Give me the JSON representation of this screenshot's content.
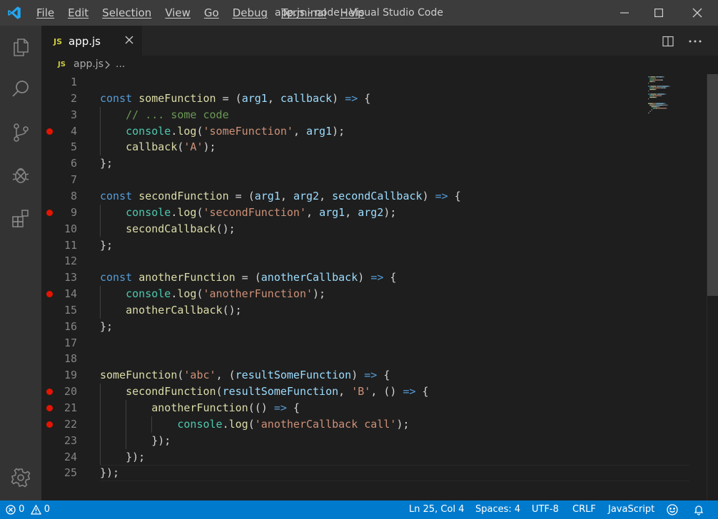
{
  "window": {
    "title": "app.js - node - Visual Studio Code",
    "menu": [
      "File",
      "Edit",
      "Selection",
      "View",
      "Go",
      "Debug",
      "Terminal",
      "Help"
    ]
  },
  "tab": {
    "icon_label": "JS",
    "file": "app.js"
  },
  "breadcrumb": {
    "icon_label": "JS",
    "file": "app.js",
    "more": "..."
  },
  "editor": {
    "lines": [
      {
        "n": "1",
        "bp": false,
        "tokens": []
      },
      {
        "n": "2",
        "bp": false,
        "tokens": [
          [
            "kw",
            "const"
          ],
          [
            "pu",
            " "
          ],
          [
            "fn",
            "someFunction"
          ],
          [
            "pu",
            " = ("
          ],
          [
            "param",
            "arg1"
          ],
          [
            "pu",
            ", "
          ],
          [
            "param",
            "callback"
          ],
          [
            "pu",
            ") "
          ],
          [
            "kw",
            "=>"
          ],
          [
            "pu",
            " {"
          ]
        ]
      },
      {
        "n": "3",
        "bp": false,
        "tokens": [
          [
            "pu",
            "    "
          ],
          [
            "com",
            "// ... some code"
          ]
        ]
      },
      {
        "n": "4",
        "bp": true,
        "tokens": [
          [
            "pu",
            "    "
          ],
          [
            "ty",
            "console"
          ],
          [
            "pu",
            "."
          ],
          [
            "fn",
            "log"
          ],
          [
            "pu",
            "("
          ],
          [
            "str",
            "'someFunction'"
          ],
          [
            "pu",
            ", "
          ],
          [
            "param",
            "arg1"
          ],
          [
            "pu",
            ");"
          ]
        ]
      },
      {
        "n": "5",
        "bp": false,
        "tokens": [
          [
            "pu",
            "    "
          ],
          [
            "fn",
            "callback"
          ],
          [
            "pu",
            "("
          ],
          [
            "str",
            "'A'"
          ],
          [
            "pu",
            ");"
          ]
        ]
      },
      {
        "n": "6",
        "bp": false,
        "tokens": [
          [
            "pu",
            "};"
          ]
        ]
      },
      {
        "n": "7",
        "bp": false,
        "tokens": []
      },
      {
        "n": "8",
        "bp": false,
        "tokens": [
          [
            "kw",
            "const"
          ],
          [
            "pu",
            " "
          ],
          [
            "fn",
            "secondFunction"
          ],
          [
            "pu",
            " = ("
          ],
          [
            "param",
            "arg1"
          ],
          [
            "pu",
            ", "
          ],
          [
            "param",
            "arg2"
          ],
          [
            "pu",
            ", "
          ],
          [
            "param",
            "secondCallback"
          ],
          [
            "pu",
            ") "
          ],
          [
            "kw",
            "=>"
          ],
          [
            "pu",
            " {"
          ]
        ]
      },
      {
        "n": "9",
        "bp": true,
        "tokens": [
          [
            "pu",
            "    "
          ],
          [
            "ty",
            "console"
          ],
          [
            "pu",
            "."
          ],
          [
            "fn",
            "log"
          ],
          [
            "pu",
            "("
          ],
          [
            "str",
            "'secondFunction'"
          ],
          [
            "pu",
            ", "
          ],
          [
            "param",
            "arg1"
          ],
          [
            "pu",
            ", "
          ],
          [
            "param",
            "arg2"
          ],
          [
            "pu",
            ");"
          ]
        ]
      },
      {
        "n": "10",
        "bp": false,
        "tokens": [
          [
            "pu",
            "    "
          ],
          [
            "fn",
            "secondCallback"
          ],
          [
            "pu",
            "();"
          ]
        ]
      },
      {
        "n": "11",
        "bp": false,
        "tokens": [
          [
            "pu",
            "};"
          ]
        ]
      },
      {
        "n": "12",
        "bp": false,
        "tokens": []
      },
      {
        "n": "13",
        "bp": false,
        "tokens": [
          [
            "kw",
            "const"
          ],
          [
            "pu",
            " "
          ],
          [
            "fn",
            "anotherFunction"
          ],
          [
            "pu",
            " = ("
          ],
          [
            "param",
            "anotherCallback"
          ],
          [
            "pu",
            ") "
          ],
          [
            "kw",
            "=>"
          ],
          [
            "pu",
            " {"
          ]
        ]
      },
      {
        "n": "14",
        "bp": true,
        "tokens": [
          [
            "pu",
            "    "
          ],
          [
            "ty",
            "console"
          ],
          [
            "pu",
            "."
          ],
          [
            "fn",
            "log"
          ],
          [
            "pu",
            "("
          ],
          [
            "str",
            "'anotherFunction'"
          ],
          [
            "pu",
            ");"
          ]
        ]
      },
      {
        "n": "15",
        "bp": false,
        "tokens": [
          [
            "pu",
            "    "
          ],
          [
            "fn",
            "anotherCallback"
          ],
          [
            "pu",
            "();"
          ]
        ]
      },
      {
        "n": "16",
        "bp": false,
        "tokens": [
          [
            "pu",
            "};"
          ]
        ]
      },
      {
        "n": "17",
        "bp": false,
        "tokens": []
      },
      {
        "n": "18",
        "bp": false,
        "tokens": []
      },
      {
        "n": "19",
        "bp": false,
        "tokens": [
          [
            "fn",
            "someFunction"
          ],
          [
            "pu",
            "("
          ],
          [
            "str",
            "'abc'"
          ],
          [
            "pu",
            ", ("
          ],
          [
            "param",
            "resultSomeFunction"
          ],
          [
            "pu",
            ") "
          ],
          [
            "kw",
            "=>"
          ],
          [
            "pu",
            " {"
          ]
        ]
      },
      {
        "n": "20",
        "bp": true,
        "tokens": [
          [
            "pu",
            "    "
          ],
          [
            "fn",
            "secondFunction"
          ],
          [
            "pu",
            "("
          ],
          [
            "param",
            "resultSomeFunction"
          ],
          [
            "pu",
            ", "
          ],
          [
            "str",
            "'B'"
          ],
          [
            "pu",
            ", () "
          ],
          [
            "kw",
            "=>"
          ],
          [
            "pu",
            " {"
          ]
        ]
      },
      {
        "n": "21",
        "bp": true,
        "tokens": [
          [
            "pu",
            "        "
          ],
          [
            "fn",
            "anotherFunction"
          ],
          [
            "pu",
            "(() "
          ],
          [
            "kw",
            "=>"
          ],
          [
            "pu",
            " {"
          ]
        ]
      },
      {
        "n": "22",
        "bp": true,
        "tokens": [
          [
            "pu",
            "            "
          ],
          [
            "ty",
            "console"
          ],
          [
            "pu",
            "."
          ],
          [
            "fn",
            "log"
          ],
          [
            "pu",
            "("
          ],
          [
            "str",
            "'anotherCallback call'"
          ],
          [
            "pu",
            ");"
          ]
        ]
      },
      {
        "n": "23",
        "bp": false,
        "tokens": [
          [
            "pu",
            "        });"
          ]
        ]
      },
      {
        "n": "24",
        "bp": false,
        "tokens": [
          [
            "pu",
            "    });"
          ]
        ]
      },
      {
        "n": "25",
        "bp": false,
        "tokens": [
          [
            "pu",
            "});"
          ]
        ]
      }
    ]
  },
  "status": {
    "errors": "0",
    "warnings": "0",
    "position": "Ln 25, Col 4",
    "spaces": "Spaces: 4",
    "encoding": "UTF-8",
    "eol": "CRLF",
    "language": "JavaScript"
  },
  "icons": {
    "activity": [
      "explorer-icon",
      "search-icon",
      "source-control-icon",
      "debug-icon",
      "extensions-icon",
      "settings-gear-icon"
    ],
    "status": [
      "error-icon",
      "warning-icon",
      "feedback-smiley-icon",
      "notification-bell-icon"
    ]
  },
  "colors": {
    "accent": "#007acc",
    "breakpoint": "#e51400",
    "keyword": "#569cd6",
    "function": "#dcdcaa",
    "parameter": "#9cdcfe",
    "string": "#ce9178",
    "comment": "#6a9955",
    "type": "#4ec9b0",
    "tab_js": "#cbcb41"
  }
}
